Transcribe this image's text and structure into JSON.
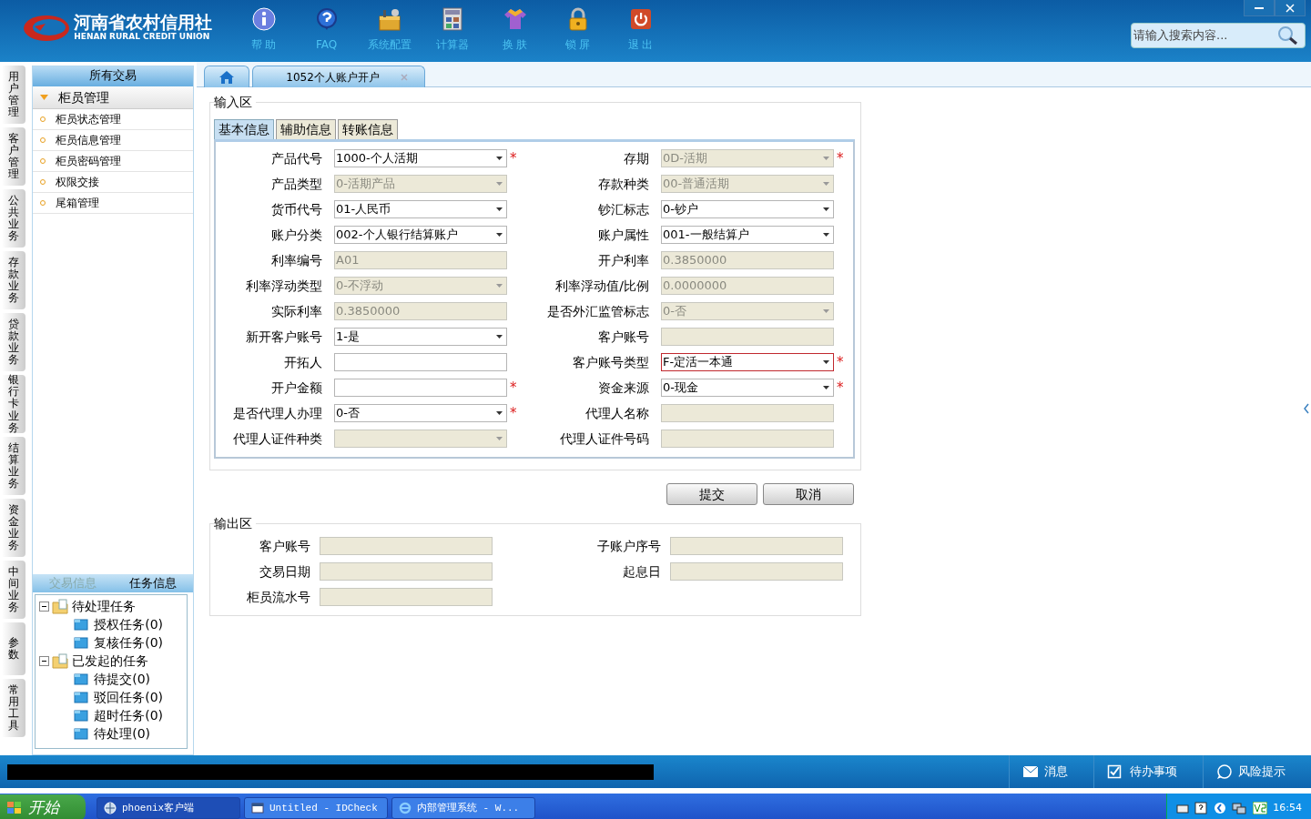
{
  "header": {
    "logo_title": "河南省农村信用社",
    "logo_subtitle": "HENAN RURAL CREDIT UNION",
    "toolbar": [
      {
        "kind": "info",
        "label": "帮 助"
      },
      {
        "kind": "help",
        "label": "FAQ"
      },
      {
        "kind": "config",
        "label": "系统配置"
      },
      {
        "kind": "calculator",
        "label": "计算器"
      },
      {
        "kind": "skin",
        "label": "换 肤"
      },
      {
        "kind": "lock",
        "label": "锁 屏"
      },
      {
        "kind": "exit",
        "label": "退 出"
      }
    ],
    "search": {
      "placeholder": "请输入搜索内容..."
    }
  },
  "side_tabs": [
    "用户管理",
    "客户管理",
    "公共业务",
    "存款业务",
    "贷款业务",
    "银行卡业务",
    "结算业务",
    "资金业务",
    "中间业务",
    "参数",
    "常用工具"
  ],
  "nav": {
    "title": "所有交易",
    "group": {
      "label": "柜员管理",
      "expanded": true,
      "items": [
        "柜员状态管理",
        "柜员信息管理",
        "柜员密码管理",
        "权限交接",
        "尾箱管理"
      ]
    }
  },
  "task_panel": {
    "tabs": [
      {
        "label": "交易信息",
        "selected": false
      },
      {
        "label": "任务信息",
        "selected": true
      }
    ],
    "tree": [
      {
        "label": "待处理任务",
        "expanded": true,
        "children": [
          {
            "label": "授权任务(0)"
          },
          {
            "label": "复核任务(0)"
          }
        ]
      },
      {
        "label": "已发起的任务",
        "expanded": true,
        "children": [
          {
            "label": "待提交(0)"
          },
          {
            "label": "驳回任务(0)"
          },
          {
            "label": "超时任务(0)"
          },
          {
            "label": "待处理(0)"
          }
        ]
      }
    ]
  },
  "page_tabs": [
    {
      "label": "1052个人账户开户",
      "selected": true
    }
  ],
  "input_area": {
    "legend": "输入区",
    "required_mark": "*",
    "tabs": [
      {
        "label": "基本信息",
        "selected": true
      },
      {
        "label": "辅助信息",
        "selected": false
      },
      {
        "label": "转账信息",
        "selected": false
      }
    ],
    "fields": [
      {
        "label": "产品代号",
        "kind": "select",
        "value": "1000-个人活期",
        "disabled": false,
        "required": true,
        "invalid": false
      },
      {
        "label": "存期",
        "kind": "select",
        "value": "0D-活期",
        "disabled": true,
        "required": true,
        "invalid": false
      },
      {
        "label": "产品类型",
        "kind": "select",
        "value": "0-活期产品",
        "disabled": true,
        "required": false,
        "invalid": false
      },
      {
        "label": "存款种类",
        "kind": "select",
        "value": "00-普通活期",
        "disabled": true,
        "required": false,
        "invalid": false
      },
      {
        "label": "货币代号",
        "kind": "select",
        "value": "01-人民币",
        "disabled": false,
        "required": false,
        "invalid": false
      },
      {
        "label": "钞汇标志",
        "kind": "select",
        "value": "0-钞户",
        "disabled": false,
        "required": false,
        "invalid": false
      },
      {
        "label": "账户分类",
        "kind": "select",
        "value": "002-个人银行结算账户",
        "disabled": false,
        "required": false,
        "invalid": false
      },
      {
        "label": "账户属性",
        "kind": "select",
        "value": "001-一般结算户",
        "disabled": false,
        "required": false,
        "invalid": false
      },
      {
        "label": "利率编号",
        "kind": "text",
        "value": "A01",
        "disabled": true,
        "required": false,
        "invalid": false
      },
      {
        "label": "开户利率",
        "kind": "text",
        "value": "0.3850000",
        "disabled": true,
        "required": false,
        "invalid": false
      },
      {
        "label": "利率浮动类型",
        "kind": "select",
        "value": "0-不浮动",
        "disabled": true,
        "required": false,
        "invalid": false
      },
      {
        "label": "利率浮动值/比例",
        "kind": "text",
        "value": "0.0000000",
        "disabled": true,
        "required": false,
        "invalid": false
      },
      {
        "label": "实际利率",
        "kind": "text",
        "value": "0.3850000",
        "disabled": true,
        "required": false,
        "invalid": false
      },
      {
        "label": "是否外汇监管标志",
        "kind": "select",
        "value": "0-否",
        "disabled": true,
        "required": false,
        "invalid": false
      },
      {
        "label": "新开客户账号",
        "kind": "select",
        "value": "1-是",
        "disabled": false,
        "required": false,
        "invalid": false
      },
      {
        "label": "客户账号",
        "kind": "text",
        "disabled": true,
        "required": false,
        "invalid": false
      },
      {
        "label": "开拓人",
        "kind": "text",
        "disabled": false,
        "required": false,
        "invalid": false
      },
      {
        "label": "客户账号类型",
        "kind": "select",
        "value": "F-定活一本通",
        "disabled": false,
        "required": true,
        "invalid": true
      },
      {
        "label": "开户金额",
        "kind": "text",
        "disabled": false,
        "required": true,
        "invalid": false
      },
      {
        "label": "资金来源",
        "kind": "select",
        "value": "0-现金",
        "disabled": false,
        "required": true,
        "invalid": false
      },
      {
        "label": "是否代理人办理",
        "kind": "select",
        "value": "0-否",
        "disabled": false,
        "required": true,
        "invalid": false
      },
      {
        "label": "代理人名称",
        "kind": "text",
        "disabled": true,
        "required": false,
        "invalid": false
      },
      {
        "label": "代理人证件种类",
        "kind": "select",
        "disabled": true,
        "required": false,
        "invalid": false
      },
      {
        "label": "代理人证件号码",
        "kind": "text",
        "disabled": true,
        "required": false,
        "invalid": false
      }
    ]
  },
  "buttons": [
    "提交",
    "取消"
  ],
  "output_area": {
    "legend": "输出区",
    "fields": [
      "客户账号",
      "子账户序号",
      "交易日期",
      "起息日",
      "柜员流水号"
    ]
  },
  "status_bar": [
    {
      "kind": "mail",
      "label": "消息"
    },
    {
      "kind": "todo",
      "label": "待办事项"
    },
    {
      "kind": "chat",
      "label": "风险提示"
    }
  ],
  "taskbar": {
    "start": "开始",
    "tasks": [
      {
        "kind": "app",
        "label": "phoenix客户端"
      },
      {
        "kind": "window",
        "label": "Untitled - IDCheck"
      },
      {
        "kind": "browser",
        "label": "内部管理系统 - W..."
      }
    ],
    "clock": "16:54"
  }
}
